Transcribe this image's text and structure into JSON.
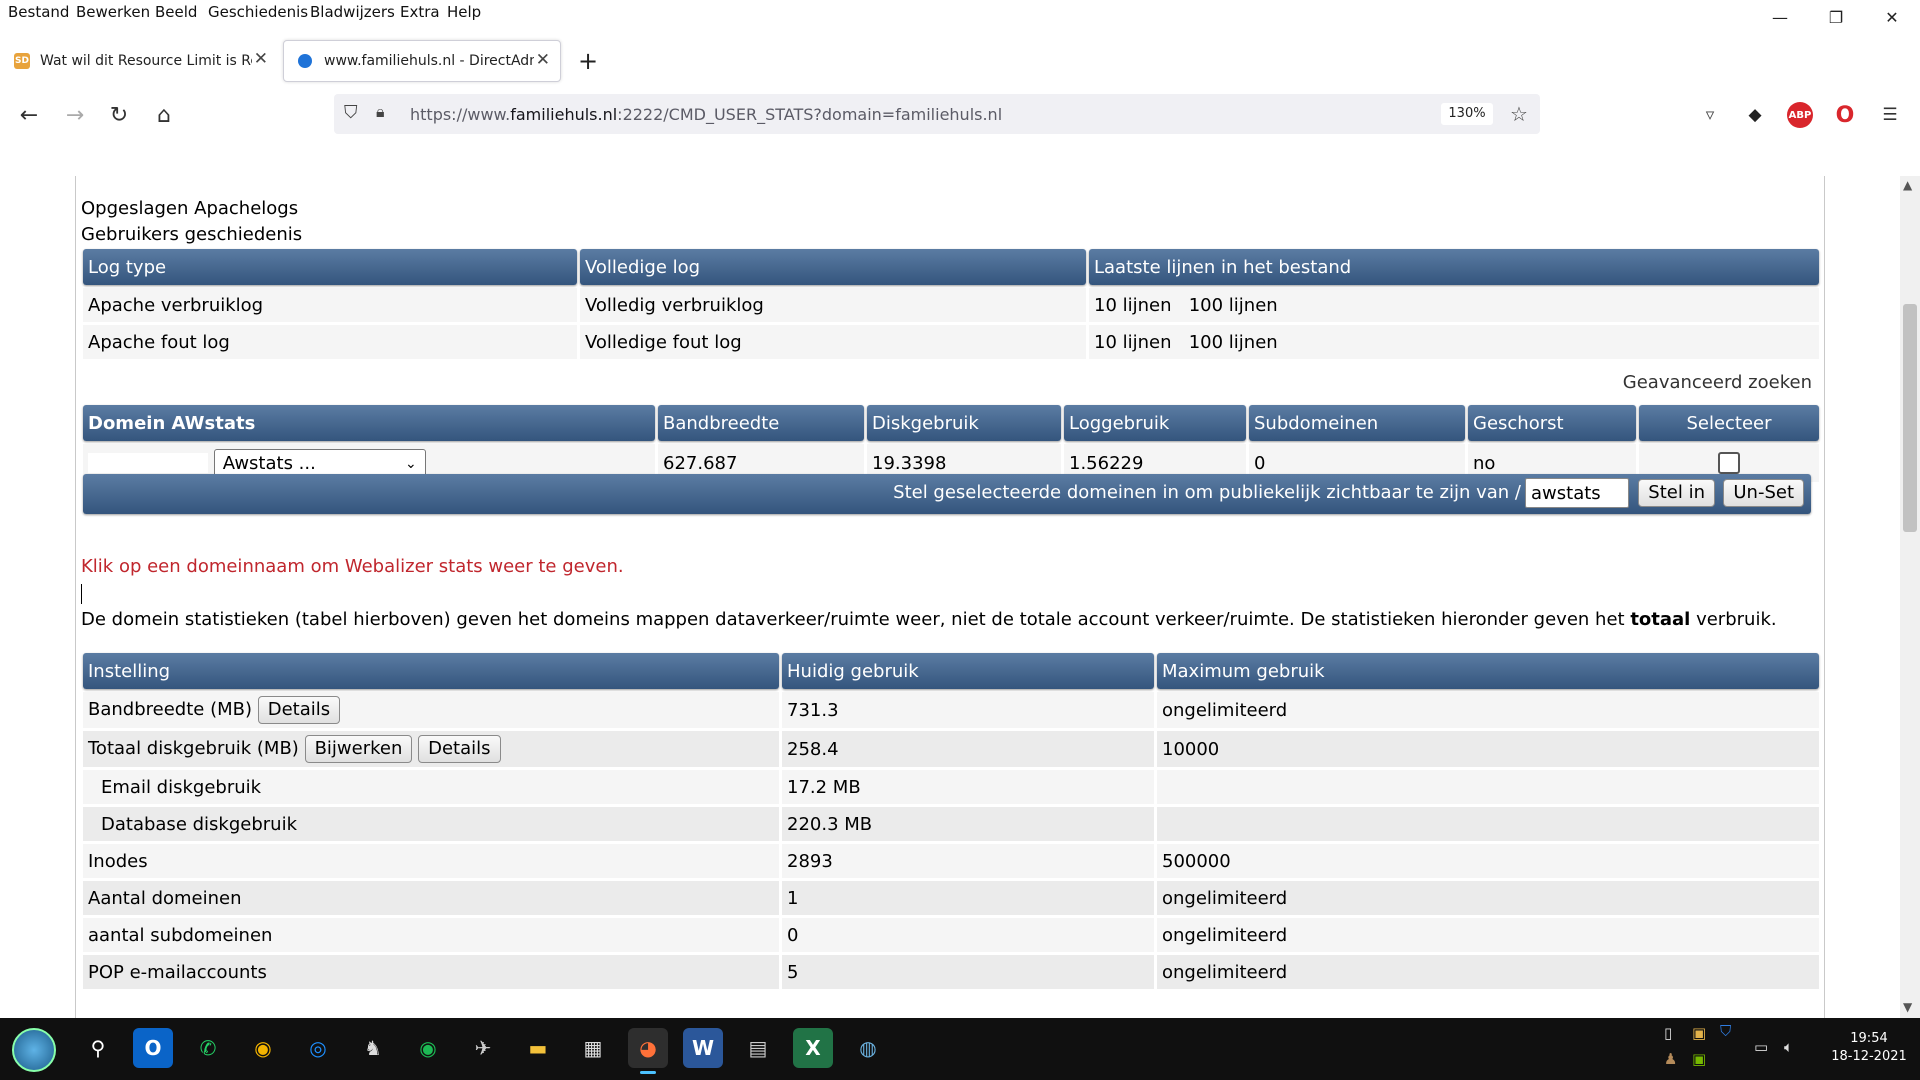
{
  "menu": [
    "Bestand",
    "Bewerken",
    "Beeld",
    "Geschiedenis",
    "Bladwijzers",
    "Extra",
    "Help"
  ],
  "tabs": [
    {
      "title": "Wat wil dit Resource Limit is Re"
    },
    {
      "title": "www.familiehuls.nl - DirectAdm"
    }
  ],
  "url": {
    "prefix": "https://www.",
    "host": "familiehuls.nl",
    "rest": ":2222/CMD_USER_STATS?domain=familiehuls.nl"
  },
  "zoom": "130%",
  "page": {
    "section1_title": "Opgeslagen Apachelogs",
    "section2_title": "Gebruikers geschiedenis",
    "logs_table": {
      "headers": [
        "Log type",
        "Volledige log",
        "Laatste lijnen in het bestand"
      ],
      "rows": [
        {
          "type": "Apache verbruiklog",
          "full": "Volledig verbruiklog",
          "last10": "10 lijnen",
          "last100": "100 lijnen"
        },
        {
          "type": "Apache fout log",
          "full": "Volledige fout log",
          "last10": "10 lijnen",
          "last100": "100 lijnen"
        }
      ]
    },
    "advanced_search": "Geavanceerd zoeken",
    "domain_table": {
      "headers": [
        "Domein AWstats",
        "Bandbreedte",
        "Diskgebruik",
        "Loggebruik",
        "Subdomeinen",
        "Geschorst",
        "Selecteer"
      ],
      "select_value": "Awstats ...",
      "row": {
        "bandwidth": "627.687",
        "disk": "19.3398",
        "log": "1.56229",
        "subdomains": "0",
        "suspended": "no"
      }
    },
    "set_public": {
      "label": "Stel geselecteerde domeinen in om publiekelijk zichtbaar te zijn van /",
      "input_value": "awstats",
      "set_button": "Stel in",
      "unset_button": "Un-Set"
    },
    "webalizer_hint": "Klik op een domeinnaam om Webalizer stats weer te geven.",
    "info_text_before": "De domein statistieken (tabel hierboven) geven het domeins mappen dataverkeer/ruimte weer, niet de totale account verkeer/ruimte. De statistieken hieronder geven het ",
    "info_text_bold": "totaal",
    "info_text_after": " verbruik.",
    "usage_table": {
      "headers": [
        "Instelling",
        "Huidig gebruik",
        "Maximum gebruik"
      ],
      "details_button": "Details",
      "update_button": "Bijwerken",
      "rows": [
        {
          "setting": "Bandbreedte (MB)",
          "current": "731.3",
          "max": "ongelimiteerd"
        },
        {
          "setting": "Totaal diskgebruik (MB)",
          "current": "258.4",
          "max": "10000"
        },
        {
          "setting": "Email diskgebruik",
          "current": "17.2 MB",
          "max": ""
        },
        {
          "setting": "Database diskgebruik",
          "current": "220.3 MB",
          "max": ""
        },
        {
          "setting": "Inodes",
          "current": "2893",
          "max": "500000"
        },
        {
          "setting": "Aantal domeinen",
          "current": "1",
          "max": "ongelimiteerd"
        },
        {
          "setting": "aantal subdomeinen",
          "current": "0",
          "max": "ongelimiteerd"
        },
        {
          "setting": "POP e-mailaccounts",
          "current": "5",
          "max": "ongelimiteerd"
        }
      ]
    }
  },
  "taskbar": {
    "time": "19:54",
    "date": "18-12-2021"
  },
  "colors": {
    "header_blue": "#34557d",
    "hint_red": "#c0262d",
    "taskbar": "#101010"
  }
}
